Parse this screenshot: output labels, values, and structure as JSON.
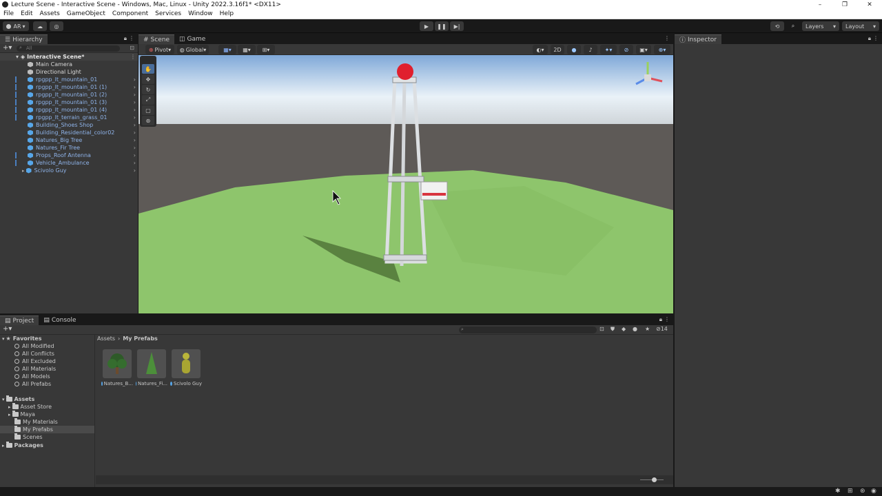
{
  "window": {
    "title": "Lecture Scene - Interactive Scene - Windows, Mac, Linux - Unity 2022.3.16f1* <DX11>",
    "controls": [
      "–",
      "❐",
      "✕"
    ]
  },
  "menu": [
    "File",
    "Edit",
    "Assets",
    "GameObject",
    "Component",
    "Services",
    "Window",
    "Help"
  ],
  "toolbar": {
    "account": "AR",
    "layers": "Layers",
    "layout": "Layout"
  },
  "hierarchy": {
    "tab": "Hierarchy",
    "search_placeholder": "All",
    "scene_name": "Interactive Scene*",
    "items": [
      {
        "label": "Main Camera"
      },
      {
        "label": "Directional Light"
      },
      {
        "label": "rpgpp_lt_mountain_01"
      },
      {
        "label": "rpgpp_lt_mountain_01 (1)"
      },
      {
        "label": "rpgpp_lt_mountain_01 (2)"
      },
      {
        "label": "rpgpp_lt_mountain_01 (3)"
      },
      {
        "label": "rpgpp_lt_mountain_01 (4)"
      },
      {
        "label": "rpgpp_lt_terrain_grass_01"
      },
      {
        "label": "Building_Shoes Shop"
      },
      {
        "label": "Building_Residential_color02"
      },
      {
        "label": "Natures_Big Tree"
      },
      {
        "label": "Natures_Fir Tree"
      },
      {
        "label": "Props_Roof Antenna"
      },
      {
        "label": "Vehicle_Ambulance"
      },
      {
        "label": "Scivolo Guy"
      }
    ]
  },
  "scene_view": {
    "tabs": [
      "Scene",
      "Game"
    ],
    "pivot": "Pivot",
    "global": "Global",
    "mode_2d": "2D"
  },
  "inspector": {
    "tab": "Inspector"
  },
  "project": {
    "tabs": [
      "Project",
      "Console"
    ],
    "breadcrumb": [
      "Assets",
      "My Prefabs"
    ],
    "hidden_count": "14",
    "favorites_label": "Favorites",
    "favorites": [
      "All Modified",
      "All Conflicts",
      "All Excluded",
      "All Materials",
      "All Models",
      "All Prefabs"
    ],
    "assets_label": "Assets",
    "asset_folders": [
      "Asset Store",
      "Maya",
      "My Materials",
      "My Prefabs",
      "Scenes"
    ],
    "packages_label": "Packages",
    "assets": [
      {
        "label": "Natures_B..."
      },
      {
        "label": "Natures_Fi..."
      },
      {
        "label": "Scivolo Guy"
      }
    ]
  }
}
